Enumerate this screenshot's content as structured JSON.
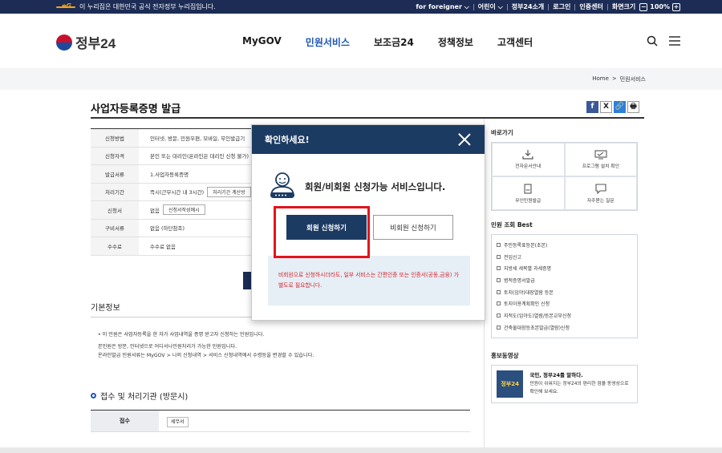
{
  "topbar": {
    "egov_label": "eG",
    "notice": "이 누리집은 대한민국 공식 전자정부 누리집입니다.",
    "links": [
      "for foreigner ⌵",
      "어린이 ⌵",
      "정부24소개",
      "로그인",
      "인증센터",
      "화면크기"
    ],
    "zoom": "100%",
    "zoom_minus": "−",
    "zoom_plus": "+"
  },
  "header": {
    "logo": "정부24",
    "nav": [
      "MyGOV",
      "민원서비스",
      "보조금24",
      "정책정보",
      "고객센터"
    ]
  },
  "breadcrumb": [
    "Home",
    "민원서비스"
  ],
  "breadcrumb_sep": ">",
  "page": {
    "title": "사업자등록증명 발급",
    "share_icons": [
      "f",
      "X",
      "🔗",
      "🖶"
    ]
  },
  "info": [
    {
      "k": "신청방법",
      "v": "인터넷, 방문, 민원우편, 모바일, 무인발급기"
    },
    {
      "k": "신청자격",
      "v": "본인 또는 대리인(온라인은 대리인 신청 불가)"
    },
    {
      "k": "발급서류",
      "v": "1.사업자등록증명"
    },
    {
      "k": "처리기간",
      "v": "즉시(근무시간 내 3시간)",
      "btn": "처리기간 계산방"
    },
    {
      "k": "신청서",
      "v": "없음",
      "btn": "신청서작성예시"
    },
    {
      "k": "구비서류",
      "v": "없음 (하단참조)"
    },
    {
      "k": "수수료",
      "v": "수수료 없음"
    }
  ],
  "basic": {
    "title": "기본정보",
    "lines": [
      "• 이 민원은 사업자등록을 한 자가 사업내역을 증명 받고자 신청하는 민원입니다.",
      "본민원은 방문, 인터넷으로 어디서나민원처리가 가능한 민원입니다.",
      "온라인발급 민원서류는 MyGOV > 나의 신청내역 > 서비스 신청내역에서 수령등을 변경할 수 있습니다."
    ]
  },
  "reception": {
    "title": "접수 및 처리기관 (방문시)",
    "row_label": "접수",
    "row_value": "세무서"
  },
  "modal": {
    "title": "확인하세요!",
    "message": "회원/비회원 신청가능 서비스입니다.",
    "member_btn": "회원 신청하기",
    "guest_btn": "비회원 신청하기",
    "notice": "비회원으로 신청하시더라도, 일부 서비스는 간편인증 또는 인증서(공동,금융) 가 별도로 필요합니다."
  },
  "sidebar": {
    "quick_title": "바로가기",
    "quick": [
      "전자문서안내",
      "프로그램 설치 확인",
      "무인민원발급",
      "자주묻는 질문"
    ],
    "best_title": "민원 조회 Best",
    "best": [
      "주민등록표등본(초본)",
      "전입신고",
      "지방세 세목별 과세증명",
      "병적증명서발급",
      "토지(임야)대장열람 등본",
      "토지이용계획확인 신청",
      "지적도(임야도)열람/등본교부신청",
      "건축물대장등초본발급(열람)신청"
    ],
    "promo_title": "홍보동영상",
    "promo_head": "국민, 정부24를 말하다.",
    "promo_body": "민원이 쉬워지는 정부24의 편리한 점을 동영상으로 확인해 보세요.",
    "promo_thumb": "정부24"
  }
}
